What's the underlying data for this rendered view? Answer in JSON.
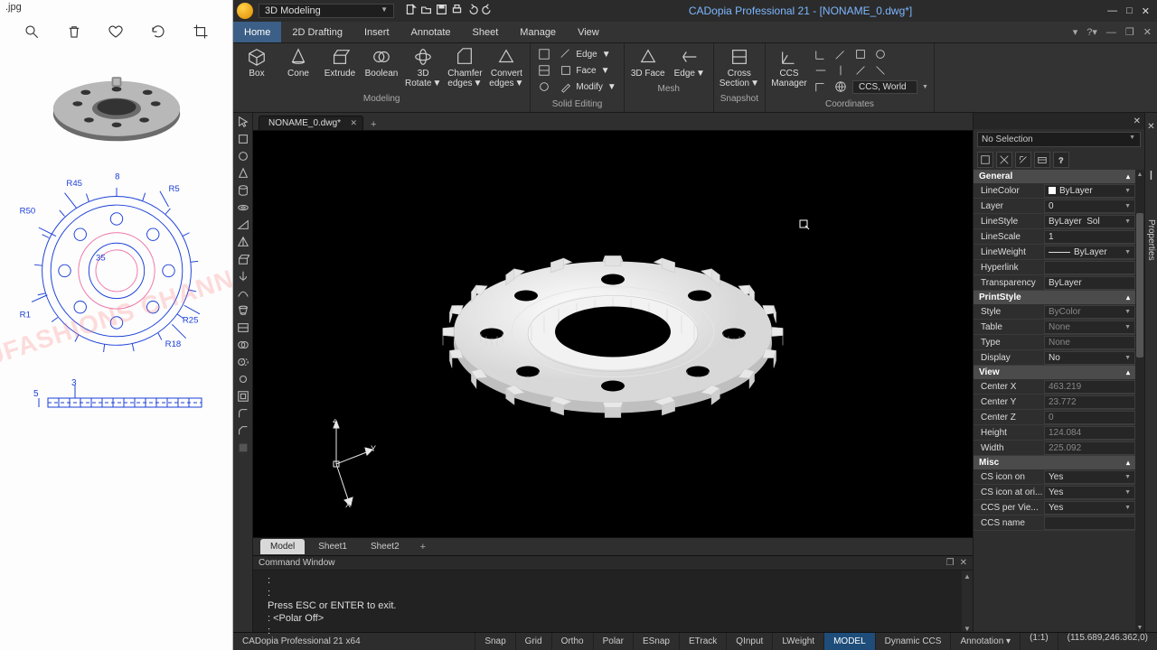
{
  "left": {
    "filename": ".jpg",
    "watermark": "NUFASHIONS CHANNEL",
    "dims": {
      "r50": "R50",
      "r45": "R45",
      "t8": "8",
      "r5": "R5",
      "r1": "R1",
      "r25": "R25",
      "r18": "R18",
      "t35": "35",
      "t5": "5",
      "t3": "3"
    }
  },
  "app": {
    "title": "CADopia Professional 21 - [NONAME_0.dwg*]",
    "workspace": "3D Modeling",
    "menu": [
      "Home",
      "2D Drafting",
      "Insert",
      "Annotate",
      "Sheet",
      "Manage",
      "View"
    ],
    "active_menu": "Home",
    "ribbon": {
      "modeling": {
        "label": "Modeling",
        "box": "Box",
        "cone": "Cone",
        "extrude": "Extrude",
        "boolean": "Boolean",
        "rotate": "3D\nRotate",
        "chamfer": "Chamfer\nedges",
        "convert": "Convert\nedges"
      },
      "solid_editing": {
        "label": "Solid Editing",
        "edge": "Edge",
        "face": "Face",
        "modify": "Modify"
      },
      "mesh": {
        "label": "Mesh",
        "face3d": "3D Face",
        "edge2": "Edge"
      },
      "snapshot": {
        "label": "Snapshot",
        "cross": "Cross\nSection"
      },
      "coordinates": {
        "label": "Coordinates",
        "ccs": "CCS\nManager",
        "field": "CCS, World"
      }
    },
    "doc_tab": "NONAME_0.dwg*",
    "ucs": {
      "x": "X",
      "y": "Y",
      "z": "Z"
    },
    "model_tabs": [
      "Model",
      "Sheet1",
      "Sheet2"
    ],
    "props": {
      "selector": "No Selection",
      "sec_general": "General",
      "linecolor_k": "LineColor",
      "linecolor_v": "ByLayer",
      "layer_k": "Layer",
      "layer_v": "0",
      "linestyle_k": "LineStyle",
      "linestyle_v": "ByLayer",
      "linestyle_v2": "Sol",
      "linescale_k": "LineScale",
      "linescale_v": "1",
      "lineweight_k": "LineWeight",
      "lineweight_v": "ByLayer",
      "hyperlink_k": "Hyperlink",
      "transparency_k": "Transparency",
      "transparency_v": "ByLayer",
      "sec_print": "PrintStyle",
      "style_k": "Style",
      "style_v": "ByColor",
      "table_k": "Table",
      "table_v": "None",
      "type_k": "Type",
      "type_v": "None",
      "display_k": "Display",
      "display_v": "No",
      "sec_view": "View",
      "cx_k": "Center X",
      "cx_v": "463.219",
      "cy_k": "Center Y",
      "cy_v": "23.772",
      "cz_k": "Center Z",
      "cz_v": "0",
      "h_k": "Height",
      "h_v": "124.084",
      "w_k": "Width",
      "w_v": "225.092",
      "sec_misc": "Misc",
      "csicon_k": "CS icon on",
      "csicon_v": "Yes",
      "csorig_k": "CS icon at ori...",
      "csorig_v": "Yes",
      "ccspv_k": "CCS per Vie...",
      "ccspv_v": "Yes",
      "ccsname_k": "CCS name"
    },
    "rail_properties": "Properties",
    "cmd": {
      "title": "Command Window",
      "l1": ":",
      "l2": ":",
      "l3": "Press ESC or ENTER to exit.",
      "l4": ":  <Polar Off>",
      "l5": ":"
    },
    "status": {
      "left": "CADopia Professional 21 x64",
      "toggles": [
        "Snap",
        "Grid",
        "Ortho",
        "Polar",
        "ESnap",
        "ETrack",
        "QInput",
        "LWeight",
        "MODEL",
        "Dynamic CCS",
        "Annotation"
      ],
      "scale": "(1:1)",
      "coords": "(115.689,246.362,0)"
    }
  }
}
